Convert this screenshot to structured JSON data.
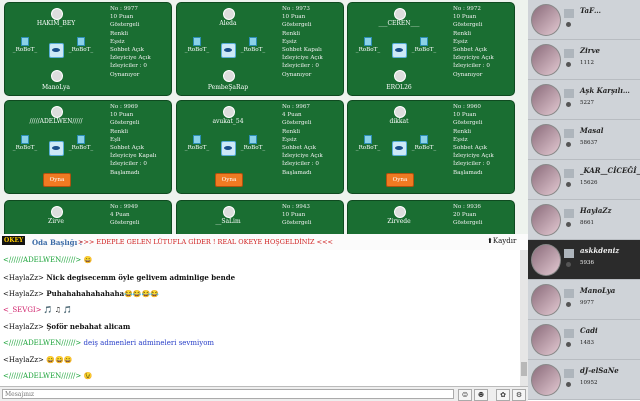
{
  "tables": [
    {
      "no": "No : 9977",
      "points": "10 Puan",
      "display": "Göstergeli",
      "color": "Renkli",
      "pair": "Eşsiz",
      "chat": "Sohbet Açık",
      "watch": "İzleyiciye Açık",
      "watchers": "İzleyiciler : 0",
      "status": "Oynanıyor",
      "top": "HAKIM_BEY",
      "bottom": "ManoLya",
      "left": "_RoBoT_",
      "right": "_RoBoT_"
    },
    {
      "no": "No : 9973",
      "points": "10 Puan",
      "display": "Göstergeli",
      "color": "Renkli",
      "pair": "Eşsiz",
      "chat": "Sohbet Kapalı",
      "watch": "İzleyiciye Açık",
      "watchers": "İzleyiciler : 0",
      "status": "Oynanıyor",
      "top": "Aleda",
      "bottom": "PembeŞaRap",
      "left": "_RoBoT_",
      "right": "_RoBoT_"
    },
    {
      "no": "No : 9972",
      "points": "10 Puan",
      "display": "Göstergeli",
      "color": "Renkli",
      "pair": "Eşsiz",
      "chat": "Sohbet Açık",
      "watch": "İzleyiciye Açık",
      "watchers": "İzleyiciler : 0",
      "status": "Oynanıyor",
      "top": "___CEREN___",
      "bottom": "EROL26",
      "left": "_RoBoT_",
      "right": "_RoBoT_"
    },
    {
      "no": "No : 9969",
      "points": "10 Puan",
      "display": "Göstergeli",
      "color": "Renkli",
      "pair": "Eşli",
      "chat": "Sohbet Açık",
      "watch": "İzleyiciye Kapalı",
      "watchers": "İzleyiciler : 0",
      "status": "Başlamadı",
      "top": "/////ADELWEN/////",
      "bottom": "",
      "left": "_RoBoT_",
      "right": "_RoBoT_",
      "button": "Oyna"
    },
    {
      "no": "No : 9967",
      "points": "4 Puan",
      "display": "Göstergeli",
      "color": "Renkli",
      "pair": "Eşsiz",
      "chat": "Sohbet Açık",
      "watch": "İzleyiciye Açık",
      "watchers": "İzleyiciler : 0",
      "status": "Başlamadı",
      "top": "avukat_54",
      "bottom": "",
      "left": "_RoBoT_",
      "right": "_RoBoT_",
      "button": "Oyna"
    },
    {
      "no": "No : 9960",
      "points": "10 Puan",
      "display": "Göstergeli",
      "color": "Renkli",
      "pair": "Eşsiz",
      "chat": "Sohbet Açık",
      "watch": "İzleyiciye Açık",
      "watchers": "İzleyiciler : 0",
      "status": "Başlamadı",
      "top": "dikkat",
      "bottom": "",
      "left": "_RoBoT_",
      "right": "_RoBoT_",
      "button": "Oyna"
    },
    {
      "no": "No : 9949",
      "points": "4 Puan",
      "display": "Göstergeli",
      "color": "",
      "pair": "",
      "chat": "",
      "watch": "",
      "watchers": "",
      "status": "",
      "top": "Zirve",
      "bottom": "",
      "left": "",
      "right": ""
    },
    {
      "no": "No : 9943",
      "points": "10 Puan",
      "display": "Göstergeli",
      "color": "",
      "pair": "",
      "chat": "",
      "watch": "",
      "watchers": "",
      "status": "",
      "top": "__SaLim",
      "bottom": "",
      "left": "",
      "right": ""
    },
    {
      "no": "No : 9936",
      "points": "20 Puan",
      "display": "Göstergeli",
      "color": "",
      "pair": "",
      "chat": "",
      "watch": "",
      "watchers": "",
      "status": "",
      "top": "Zirvede",
      "bottom": "",
      "left": "",
      "right": ""
    }
  ],
  "chat": {
    "logo": "OKEY",
    "title": "Oda Başlığı :",
    "marquee": ">>> EDEPLE GELEN LÜTUFLA GİDER ! REAL OKEYE HOŞGELDİNİZ <<<",
    "scroll_label": "Kaydır",
    "messages": [
      {
        "who": "<//////ADELWEN//////>",
        "text": " 😄"
      },
      {
        "who": "<HaylaZz>",
        "text": " Nick degisecemm öyle gelivem adminlige bende"
      },
      {
        "who": "<HaylaZz>",
        "text": " Puhahahahahahaha😂😂😂😂"
      },
      {
        "who": "<_SEVGI>",
        "text": " 🎵 ♫ 🎵"
      },
      {
        "who": "<HaylaZz>",
        "text": " Şoför nebahat alicam"
      },
      {
        "who": "<//////ADELWEN//////>",
        "text": " deiş admenleri admineleri sevmiyom"
      },
      {
        "who": "<HaylaZz>",
        "text": " 😄😄😄"
      },
      {
        "who": "<//////ADELWEN//////>",
        "text": " 😉"
      }
    ],
    "input_placeholder": "Mesajınız"
  },
  "users": [
    {
      "name": "TaF…",
      "points": "",
      "dark": false
    },
    {
      "name": "Zirve",
      "points": "1112",
      "dark": false
    },
    {
      "name": "Aşk Karşılı…",
      "points": "5227",
      "dark": false
    },
    {
      "name": "Masal",
      "points": "58637",
      "dark": false
    },
    {
      "name": "_KAR__CİCEĞİ_",
      "points": "15626",
      "dark": false
    },
    {
      "name": "HaylaZz",
      "points": "8661",
      "dark": false
    },
    {
      "name": "askkdeniz",
      "points": "5936",
      "dark": true
    },
    {
      "name": "ManoLya",
      "points": "9977",
      "dark": false
    },
    {
      "name": "Cadi",
      "points": "1483",
      "dark": false
    },
    {
      "name": "dJ-elSaNe",
      "points": "10952",
      "dark": false
    }
  ]
}
